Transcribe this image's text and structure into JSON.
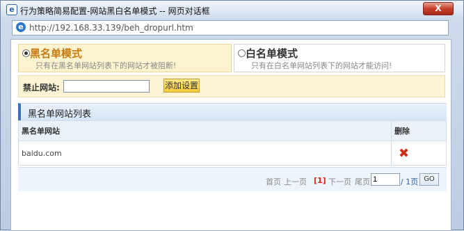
{
  "window": {
    "title": "行为策略简易配置-网站黑白名单模式 -- 网页对话框",
    "close_label": "X",
    "url": "http://192.168.33.139/beh_dropurl.htm"
  },
  "modes": [
    {
      "title": "黑名单模式",
      "desc": "只有在黑名单网站列表下的网站才被阻断!",
      "selected": true
    },
    {
      "title": "白名单模式",
      "desc": "只有在白名单网站列表下的网站才能访问!",
      "selected": false
    }
  ],
  "block": {
    "label": "禁止网站:",
    "input_value": "",
    "add_label": "添加设置"
  },
  "list": {
    "title": "黑名单网站列表",
    "columns": [
      "黑名单网站",
      "删除"
    ],
    "rows": [
      {
        "site": "baidu.com"
      }
    ]
  },
  "pager": {
    "first": "首页",
    "prev": "上一页",
    "current": "[1]",
    "next": "下一页",
    "last": "尾页",
    "page_value": "1",
    "total": "/ 1页",
    "go": "GO"
  }
}
